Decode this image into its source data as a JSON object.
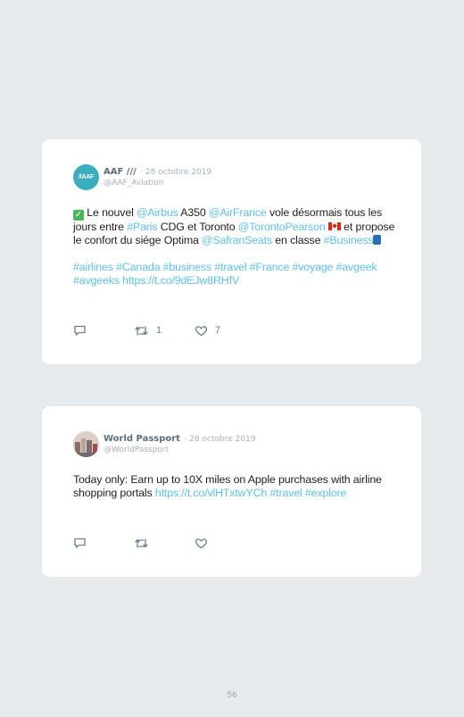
{
  "tweets": [
    {
      "avatar_text": "//AAF",
      "name": "AAF ///",
      "date": "· 28 octobre 2019",
      "handle": "@AAF_Aviation",
      "parts": {
        "p1": " Le nouvel ",
        "l1": "@Airbus",
        "p2": " A350 ",
        "l2": "@AirFrance",
        "p3": " vole désormais tous les jours entre ",
        "l3": "#Paris",
        "p4": " CDG et Toronto ",
        "l4": "@TorontoPearson",
        "p5": " et propose le confort du siége Optima ",
        "l5": "@SafranSeats",
        "p6": " en classe ",
        "l6": "#Business",
        "tags": "#airlines #Canada #business #travel #France #voyage #avgeek #avgeeks",
        "url": "https://t.co/9dEJw8RHfV"
      },
      "retweets": "1",
      "likes": "7"
    },
    {
      "name": "World Passport",
      "date": "· 28 octobre 2019",
      "handle": "@WorldPassport",
      "parts": {
        "p1": "Today only: Earn up to 10X miles on Apple purchases with airline shopping portals ",
        "url": "https://t.co/vlHTxtwYCh",
        "t1": "#travel",
        "t2": "#explore"
      }
    }
  ],
  "page_number": "56",
  "colors": {
    "link": "#5fbfe8",
    "background": "#e7eaed",
    "card": "#ffffff"
  },
  "icons": [
    "reply-icon",
    "retweet-icon",
    "like-icon"
  ]
}
